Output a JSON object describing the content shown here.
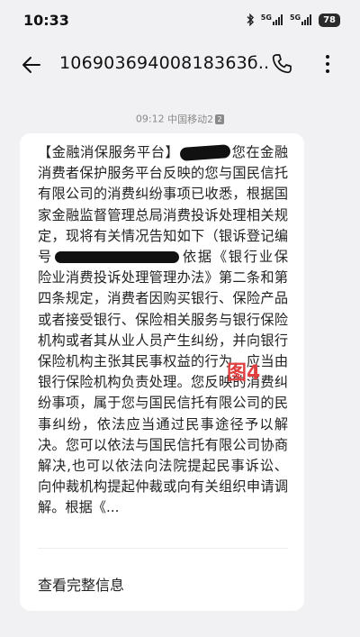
{
  "status_bar": {
    "time": "10:33",
    "network_1": "5G",
    "network_2": "5G",
    "battery": "78",
    "icons": [
      "bluetooth-icon",
      "signal-5g-icon",
      "signal-5g-icon",
      "battery-icon"
    ]
  },
  "header": {
    "title": "10690369400818363б...",
    "icons": [
      "back-arrow-icon",
      "phone-icon",
      "more-vertical-icon"
    ]
  },
  "message_meta": {
    "time": "09:12",
    "carrier": "中国移动2",
    "sim": "2"
  },
  "message": {
    "part_1": "【金融消保服务平台】",
    "part_2": "您在金融消费者保护服务平台反映的您与国民信托有限公司的消费纠纷事项已收悉，根据国家金融监督管理总局消费投诉处理相关规定，现将有关情况告知如下（银诉登记编号",
    "part_3": "依据《银行业保险业消费投诉处理管理办法》第二条和第四条规定，消费者因购买银行、保险产品或者接受银行、保险相关服务与银行保险机构或者其从业人员产生纠纷，并向银行保险机构主张其民事权益的行为，应当由银行保险机构负责处理。您反映的消费纠纷事项，属于您与国民信托有限公司的民事纠纷，依法应当通过民事途径予以解决。您可以依法与国民信托有限公司协商解决,也可以依法向法院提起民事诉讼、向仲裁机构提起仲裁或向有关组织申请调解。根据《...",
    "view_full_label": "查看完整信息"
  },
  "annotation": {
    "figure_label": "图4",
    "color": "#e04040"
  }
}
